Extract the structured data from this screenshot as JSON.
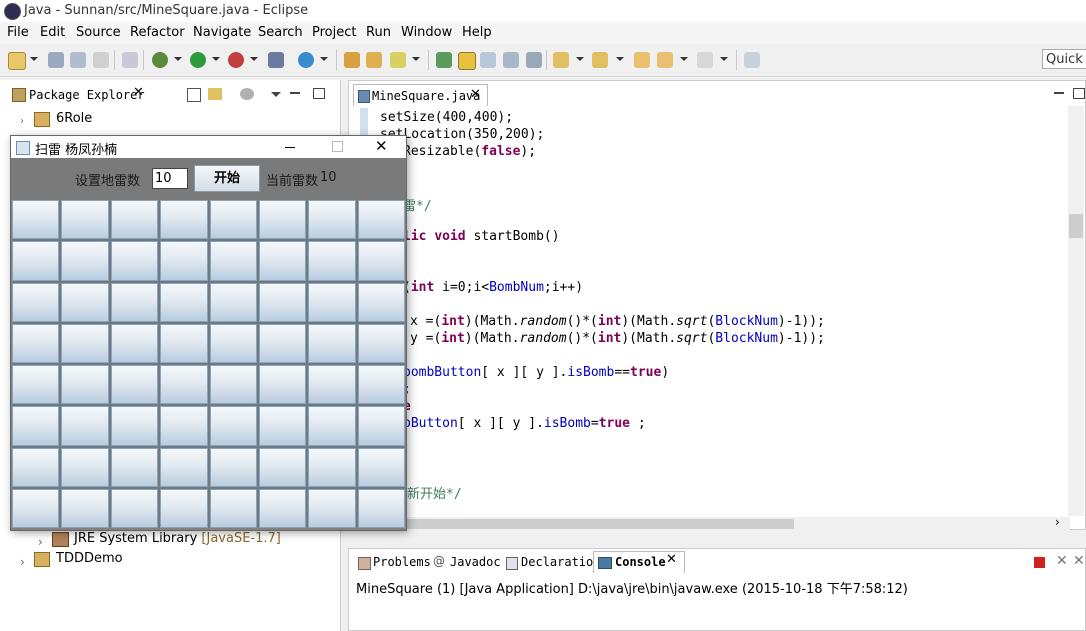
{
  "window": {
    "title": "Java - Sunnan/src/MineSquare.java - Eclipse"
  },
  "menu": [
    "File",
    "Edit",
    "Source",
    "Refactor",
    "Navigate",
    "Search",
    "Project",
    "Run",
    "Window",
    "Help"
  ],
  "quick_access": "Quick A",
  "package_explorer": {
    "tab": "Package Explorer",
    "items": [
      {
        "label": "6Role"
      },
      {
        "label": "JRE System Library",
        "suffix": "[JavaSE-1.7]"
      },
      {
        "label": "TDDDemo"
      }
    ]
  },
  "editor": {
    "tab": "MineSquare.java",
    "lines": [
      {
        "t": "setSize(400,400);"
      },
      {
        "t": "setLocation(350,200);"
      },
      {
        "t": "Resizable(false);"
      },
      {
        "t": "雷*/"
      },
      {
        "t": "lic void startBomb()"
      },
      {
        "t": "(int i=0;i<BombNum;i++)"
      },
      {
        "t": "x =(int)(Math.random()*(int)(Math.sqrt(BlockNum)-1));"
      },
      {
        "t": "y =(int)(Math.random()*(int)(Math.sqrt(BlockNum)-1));"
      },
      {
        "t": "bombButton[ x ][ y ].isBomb==true)"
      },
      {
        "t": ";"
      },
      {
        "t": "e"
      },
      {
        "t": "bButton[ x ][ y ].isBomb=true ;"
      },
      {
        "t": "新开始*/"
      }
    ]
  },
  "console": {
    "tabs": [
      "Problems",
      "Javadoc",
      "Declaration",
      "Console"
    ],
    "text": "MineSquare (1) [Java Application] D:\\java\\jre\\bin\\javaw.exe (2015-10-18 下午7:58:12)"
  },
  "mine_window": {
    "title": "扫雷  杨凤孙楠",
    "set_label": "设置地雷数",
    "input_value": "10",
    "start_button": "开始",
    "current_label": "当前雷数",
    "current_value": "10",
    "grid_rows": 8,
    "grid_cols": 8
  }
}
